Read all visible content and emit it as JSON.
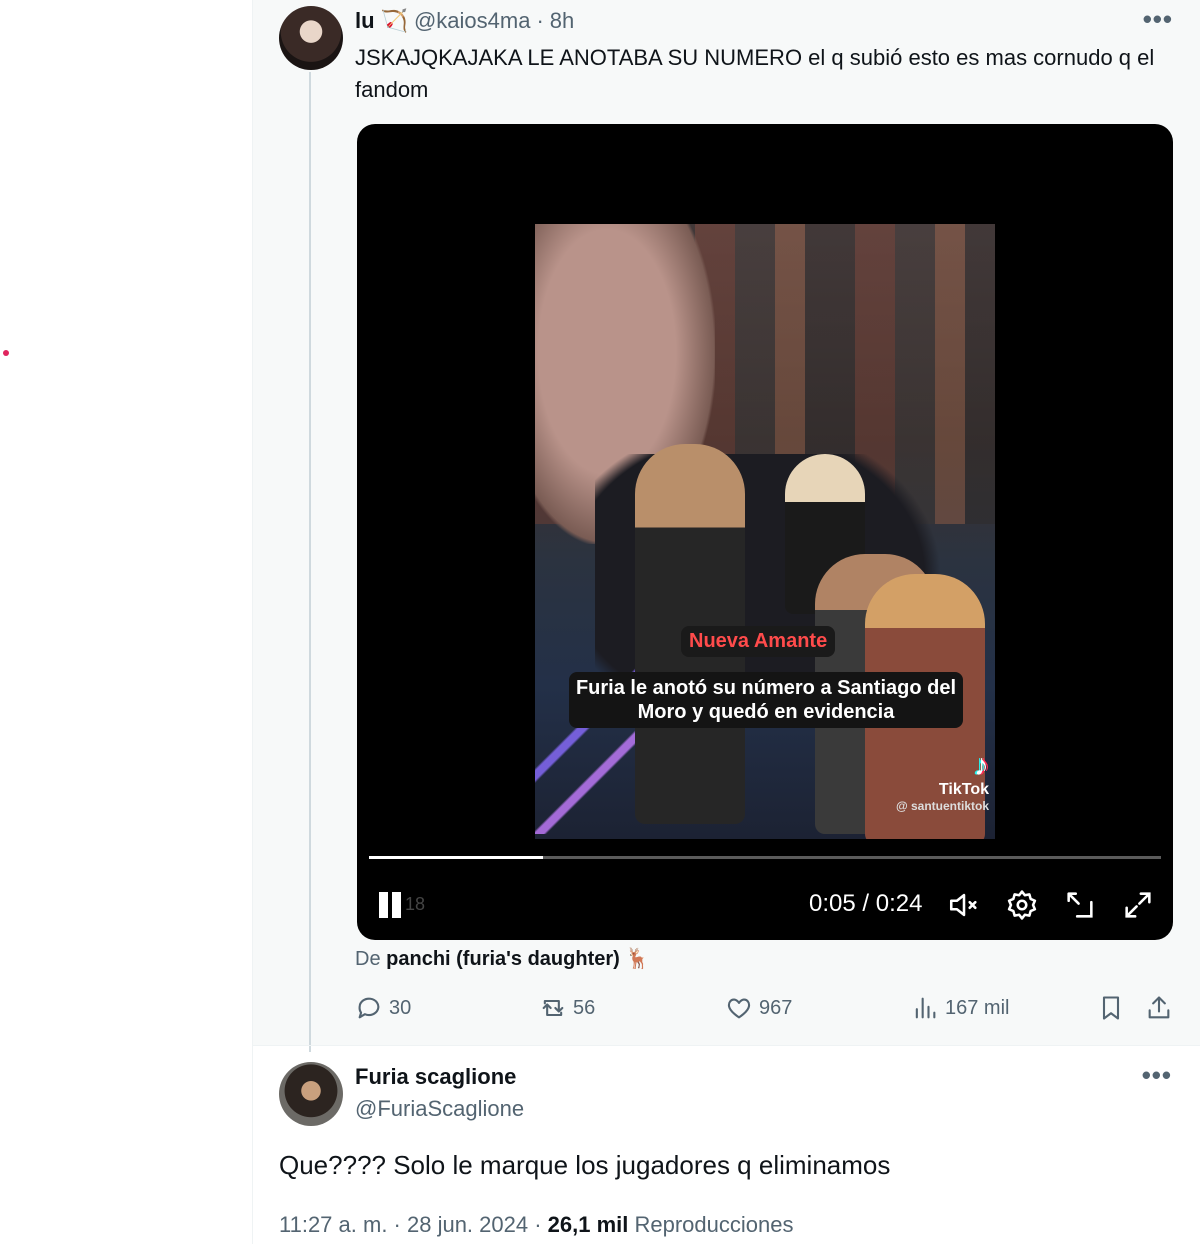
{
  "tweet": {
    "display_name": "lu",
    "name_emoji": "🏹",
    "handle": "@kaios4ma",
    "separator": "·",
    "time": "8h",
    "more_label": "•••",
    "text": "JSKAJQKAJAKA LE ANOTABA SU NUMERO el q subió esto es mas cornudo q el fandom",
    "video": {
      "caption_red": "Nueva Amante",
      "caption_white": "Furia le anotó su número a Santiago del Moro y quedó en evidencia",
      "tiktok_note": "♪",
      "tiktok_label": "TikTok",
      "tiktok_user": "@ santuentiktok",
      "progress": 0.22,
      "pause_ghost": "18",
      "timecode": "0:05 / 0:24"
    },
    "from_prefix": "De",
    "from_name": "panchi (furia's daughter) 🦌",
    "actions": {
      "replies": "30",
      "reposts": "56",
      "likes": "967",
      "views": "167 mil"
    }
  },
  "reply": {
    "display_name": "Furia scaglione",
    "handle": "@FuriaScaglione",
    "more_label": "•••",
    "text": "Que???? Solo le marque los jugadores q eliminamos",
    "meta_time": "11:27 a. m. · 28 jun. 2024 ·",
    "meta_views": "26,1 mil",
    "meta_views_label": "Reproducciones"
  }
}
